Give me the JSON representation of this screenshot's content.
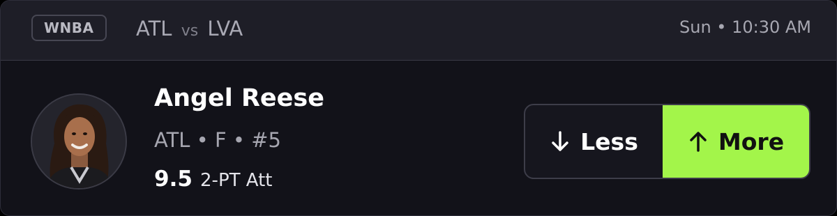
{
  "header": {
    "league": "WNBA",
    "home_team": "ATL",
    "vs": "vs",
    "away_team": "LVA",
    "game_time": "Sun • 10:30 AM"
  },
  "player": {
    "name": "Angel Reese",
    "meta": "ATL • F • #5",
    "line_value": "9.5",
    "stat_label": "2-PT Att"
  },
  "picks": {
    "less_label": "Less",
    "more_label": "More"
  },
  "colors": {
    "accent": "#a3f54a",
    "card_bg": "#121219",
    "header_bg": "#1e1e27"
  },
  "icons": {
    "less": "arrow-down-icon",
    "more": "arrow-up-icon"
  }
}
